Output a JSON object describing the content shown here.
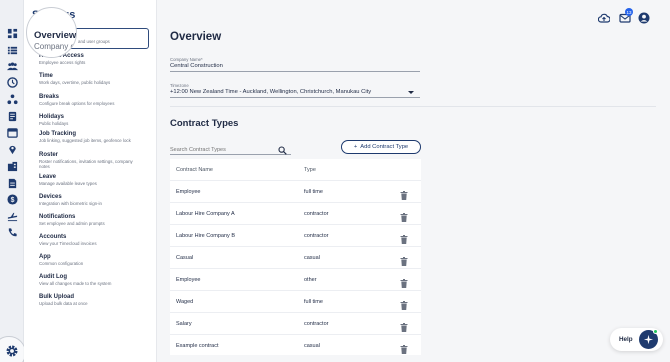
{
  "settings": {
    "title": "Settings",
    "selected": {
      "title": "Overview",
      "subtitle": "Company d",
      "desc": "and user groups"
    },
    "items": [
      {
        "label": "Roles & Access",
        "desc": "Employee access rights"
      },
      {
        "label": "Time",
        "desc": "Work days, overtime, public holidays"
      },
      {
        "label": "Breaks",
        "desc": "Configure break options for employees"
      },
      {
        "label": "Holidays",
        "desc": "Public holidays"
      },
      {
        "label": "Job Tracking",
        "desc": "Job linking, suggested job items, geofence lock"
      },
      {
        "label": "Roster",
        "desc": "Roster notifications, invitation settings, company notes"
      },
      {
        "label": "Leave",
        "desc": "Manage available leave types"
      },
      {
        "label": "Devices",
        "desc": "Integration with biometric sign-in"
      },
      {
        "label": "Notifications",
        "desc": "Set employee and admin prompts"
      },
      {
        "label": "Accounts",
        "desc": "View your Timecloud invoices"
      },
      {
        "label": "App",
        "desc": "Common configuration"
      },
      {
        "label": "Audit Log",
        "desc": "View all changes made to the system"
      },
      {
        "label": "Bulk Upload",
        "desc": "Upload bulk data at once"
      }
    ]
  },
  "header": {
    "notification_count": "13"
  },
  "overview": {
    "title": "Overview",
    "company_label": "Company Name*",
    "company_value": "Central Construction",
    "timezone_label": "Timezone",
    "timezone_value": "+12:00 New Zealand Time - Auckland, Wellington, Christchurch, Manukau City"
  },
  "contract_types": {
    "title": "Contract Types",
    "search_placeholder": "Search Contract Types",
    "add_label": "Add Contract Type",
    "columns": [
      "Contract Name",
      "Type"
    ],
    "rows": [
      {
        "name": "Employee",
        "type": "full time"
      },
      {
        "name": "Labour Hire Company A",
        "type": "contractor"
      },
      {
        "name": "Labour Hire Company B",
        "type": "contractor"
      },
      {
        "name": "Casual",
        "type": "casual"
      },
      {
        "name": "Employee",
        "type": "other"
      },
      {
        "name": "Waged",
        "type": "full time"
      },
      {
        "name": "Salary",
        "type": "contractor"
      },
      {
        "name": "Example contract",
        "type": "casual"
      }
    ]
  },
  "help": {
    "label": "Help"
  },
  "icons": {
    "rail": [
      "dashboard-icon",
      "list-icon",
      "people-icon",
      "clock-icon",
      "org-chart-icon",
      "report-icon",
      "calendar-icon",
      "location-icon",
      "building-icon",
      "document-icon",
      "dollar-icon",
      "airplane-icon",
      "phone-icon"
    ],
    "colors": {
      "primary": "#1e3a6e",
      "accent": "#2563eb"
    }
  }
}
